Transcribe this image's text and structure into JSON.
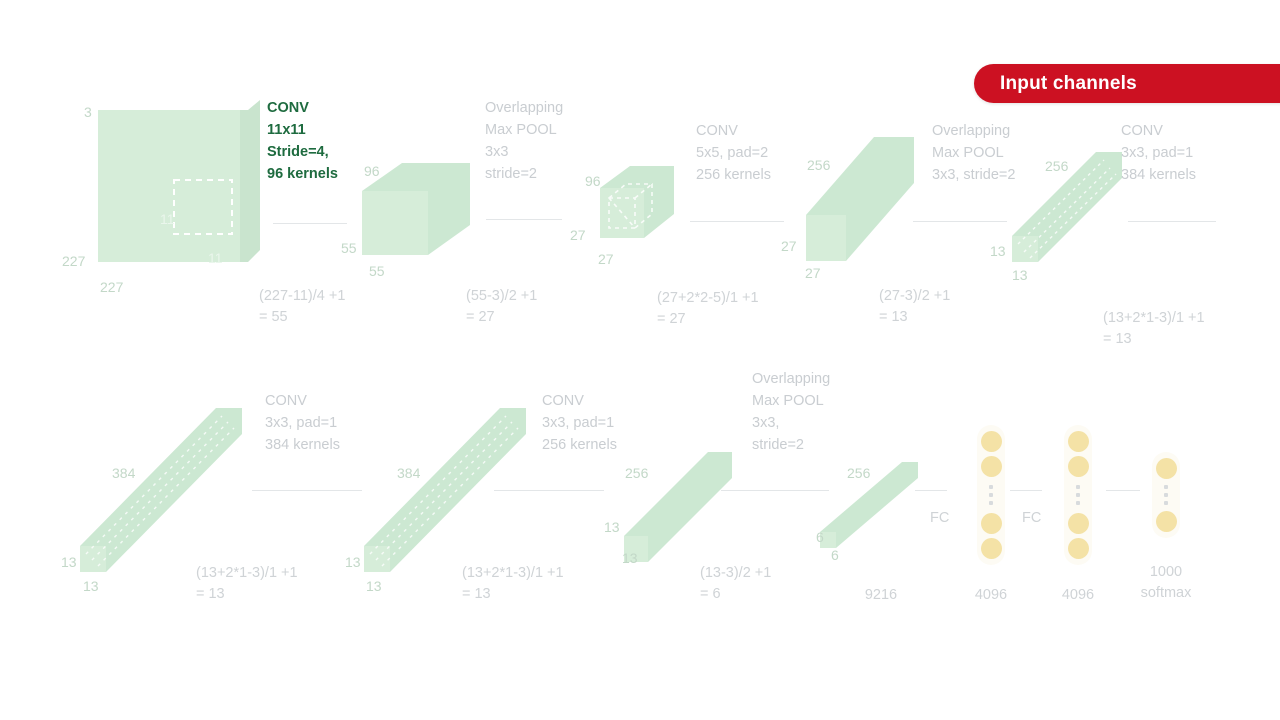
{
  "banner": {
    "label": "Input channels",
    "color": "#cc1122",
    "text_color": "#ffffff"
  },
  "palette": {
    "block_fill": "#d4ecd8",
    "block_fill_dark": "#c5e4cb",
    "accent_green": "#1e6b3f",
    "muted_text": "#c9cdd1",
    "dim_text": "#c3d8c8",
    "fc_dot": "#f4e2a6",
    "connector": "#e3e6e8"
  },
  "row1": {
    "blocks": [
      {
        "name": "input-image",
        "dim_depth": "3",
        "dim_left": "227",
        "dim_bottom": "227",
        "kernel_left": "11",
        "kernel_bottom": "11"
      },
      {
        "name": "conv1-output",
        "dim_depth": "96",
        "dim_left": "55",
        "dim_bottom": "55"
      },
      {
        "name": "pool1-output",
        "dim_depth": "96",
        "dim_left": "27",
        "dim_bottom": "27"
      },
      {
        "name": "conv2-output",
        "dim_depth": "256",
        "dim_left": "27",
        "dim_bottom": "27"
      },
      {
        "name": "pool2-output",
        "dim_depth": "256",
        "dim_left": "13",
        "dim_bottom": "13"
      }
    ],
    "ops": [
      {
        "name": "conv1",
        "lines": "CONV\n11x11\nStride=4,\n96 kernels",
        "formula": "(227-11)/4 +1\n= 55",
        "highlight": true
      },
      {
        "name": "maxpool1",
        "lines": "Overlapping\nMax POOL\n3x3\nstride=2",
        "formula": "(55-3)/2 +1\n= 27",
        "highlight": false
      },
      {
        "name": "conv2",
        "lines": "CONV\n5x5, pad=2\n256 kernels",
        "formula": "(27+2*2-5)/1 +1\n= 27",
        "highlight": false
      },
      {
        "name": "maxpool2",
        "lines": "Overlapping\nMax POOL\n3x3, stride=2",
        "formula": "(27-3)/2 +1\n= 13",
        "highlight": false
      },
      {
        "name": "conv3",
        "lines": "CONV\n3x3, pad=1\n384 kernels",
        "formula": "(13+2*1-3)/1 +1\n= 13",
        "highlight": false
      }
    ]
  },
  "row2": {
    "blocks": [
      {
        "name": "conv3-output",
        "dim_depth": "384",
        "dim_left": "13",
        "dim_bottom": "13"
      },
      {
        "name": "conv4-output",
        "dim_depth": "384",
        "dim_left": "13",
        "dim_bottom": "13"
      },
      {
        "name": "conv5-output",
        "dim_depth": "256",
        "dim_left": "13",
        "dim_bottom": "13"
      },
      {
        "name": "pool3-output",
        "dim_depth": "256",
        "dim_left": "6",
        "dim_bottom": "6",
        "flat_label": "9216"
      }
    ],
    "ops": [
      {
        "name": "conv4",
        "lines": "CONV\n3x3, pad=1\n384 kernels",
        "formula": "(13+2*1-3)/1 +1\n= 13"
      },
      {
        "name": "conv5",
        "lines": "CONV\n3x3, pad=1\n256 kernels",
        "formula": "(13+2*1-3)/1 +1\n= 13"
      },
      {
        "name": "maxpool3",
        "lines": "Overlapping\nMax POOL\n3x3,\nstride=2",
        "formula": "(13-3)/2 +1\n= 6"
      }
    ],
    "fc": [
      {
        "name": "fc6",
        "connector_label": "FC",
        "size_label": "4096",
        "dots": 4
      },
      {
        "name": "fc7",
        "connector_label": "FC",
        "size_label": "4096",
        "dots": 4
      },
      {
        "name": "fc8",
        "connector_label": "",
        "size_label": "1000\nsoftmax",
        "dots": 2
      }
    ]
  }
}
